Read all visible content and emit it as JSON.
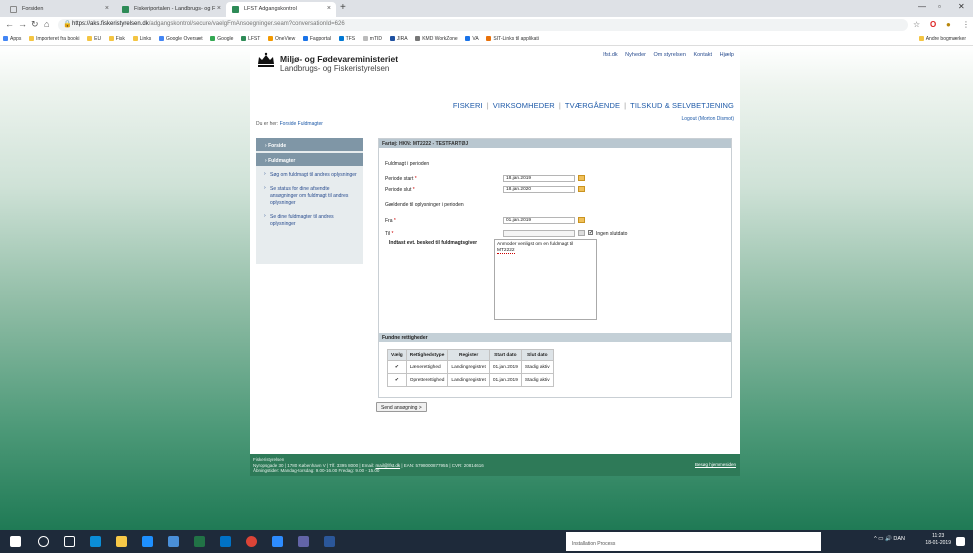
{
  "browser": {
    "tabs": [
      {
        "title": "Forsiden",
        "color": "#ffffff"
      },
      {
        "title": "Fiskeriportalen - Landbrugs- og F",
        "color": "#2e8b57"
      },
      {
        "title": "LFST Adgangskontrol",
        "color": "#2e8b57"
      }
    ],
    "url_host": "https://aks.fiskeristyrelsen.dk",
    "url_path": "/adgangskontrol/secure/vaelgFmAnsoegninger.seam?conversationId=626",
    "bookmarks": [
      "Apps",
      "Importeret fra booki",
      "EU",
      "Fisk",
      "Links",
      "Google Oversæt",
      "Google",
      "LFST",
      "OneView",
      "Fagportal",
      "TFS",
      "mTID",
      "JIRA",
      "KMD WorkZone",
      "VA",
      "SIT-Links til applikati"
    ],
    "bookmarks_right": "Andre bogmærker"
  },
  "site": {
    "logo_main": "Miljø- og Fødevareministeriet",
    "logo_sub": "Landbrugs- og Fiskeristyrelsen",
    "top_links": [
      "lfst.dk",
      "Nyheder",
      "Om styrelsen",
      "Kontakt",
      "Hjælp"
    ],
    "main_nav": [
      "FISKERI",
      "VIRKSOMHEDER",
      "TVÆRGÅENDE",
      "TILSKUD & SELVBETJENING"
    ],
    "logout": "Logout (Morton Dismot)",
    "breadcrumb_prefix": "Du er her:",
    "breadcrumb_link": "Forside Fuldmagter"
  },
  "sidebar": {
    "forside": "Forside",
    "fuldmagter": "Fuldmagter",
    "links": [
      "Søg om fuldmagt til andres oplysninger",
      "Se status for dine afsendte ansøgninger om fuldmagt til andres oplysninger",
      "Se dine fuldmagter til andres oplysninger"
    ]
  },
  "form": {
    "header": "Fartøj: HKN: MT2222 - TESTFARTØJ",
    "section1": "Fuldmagt i perioden",
    "periode_start_label": "Periode start",
    "periode_start_value": "18.jan.2019",
    "periode_slut_label": "Periode slut",
    "periode_slut_value": "18.jan.2020",
    "section2": "Gældende til oplysninger i perioden",
    "fra_label": "Fra",
    "fra_value": "01.jan.2019",
    "til_label": "Til",
    "til_value": "",
    "ingen_slutdato": "Ingen slutdato",
    "besked_label": "Indtast evt. besked til fuldmagtsgiver",
    "besked_line1": "Anmoder venligst om en fuldmagt til",
    "besked_line2": "MT2222",
    "rights_header": "Fundne rettigheder",
    "table_headers": [
      "Vælg",
      "Rettighedstype",
      "Register",
      "Start dato",
      "Slut dato"
    ],
    "rows": [
      {
        "type": "Lænerettighed",
        "register": "Landingregistret",
        "start": "01.jan.2019",
        "slut": "Stadig aktiv"
      },
      {
        "type": "Opretterettighed",
        "register": "Landingregistret",
        "start": "01.jan.2019",
        "slut": "Stadig aktiv"
      }
    ],
    "send_button": "Send ansøgning >"
  },
  "footer": {
    "line1": "Fiskeristyrelsen",
    "line2_prefix": "Nyropsgade 30 | 1780 København V | Tlf. 3395 8000 | Email:",
    "email": "mail@lfst.dk",
    "line2_suffix": "| EAN: 5798000877955 | CVR: 20814616",
    "line3": "Åbningstider: Mandag-torsdag: 9.00-16.00 Fredag: 9.00 - 15.00",
    "right_link": "Besøg hjemmesiden"
  },
  "taskbar": {
    "search_placeholder": "Installation Process",
    "tray": "DAN",
    "time": "11:23",
    "date": "18-01-2019"
  }
}
